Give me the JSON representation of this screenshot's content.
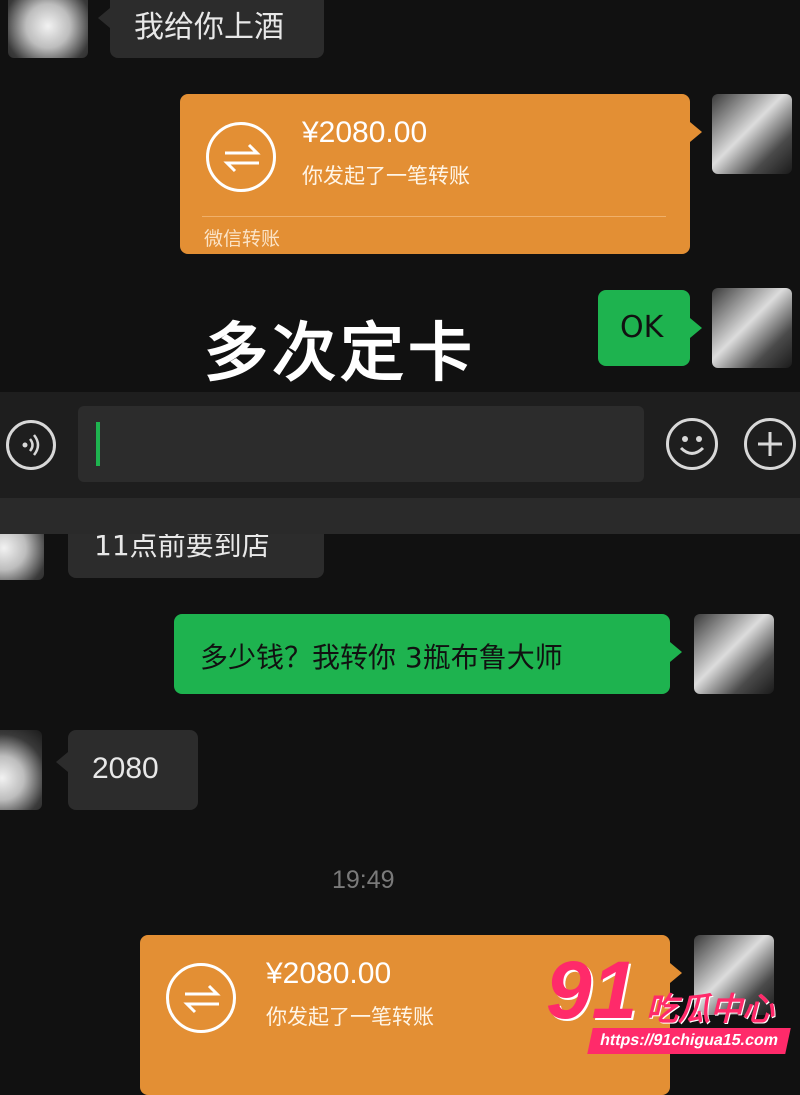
{
  "top": {
    "msg1": "我给你上酒",
    "transfer1": {
      "amount": "¥2080.00",
      "desc": "你发起了一笔转账",
      "footer": "微信转账"
    },
    "caption": "多次定卡",
    "ok": "OK"
  },
  "inputbar": {
    "cursor": "|"
  },
  "bottom": {
    "partial": "11点前要到店",
    "question": "多少钱？我转你 3瓶布鲁大师",
    "reply": "2080",
    "time": "19:49",
    "transfer2": {
      "amount": "¥2080.00",
      "desc": "你发起了一笔转账"
    }
  },
  "watermark": {
    "logo_num": "91",
    "logo_text": "吃瓜中心",
    "url": "https://91chigua15.com"
  },
  "icons": [
    "transfer-icon",
    "voice-icon",
    "emoji-icon",
    "plus-icon"
  ],
  "colors": {
    "green": "#1eb34f",
    "orange": "#e38f34",
    "bg": "#111111",
    "watermark": "#ff2a6a"
  }
}
